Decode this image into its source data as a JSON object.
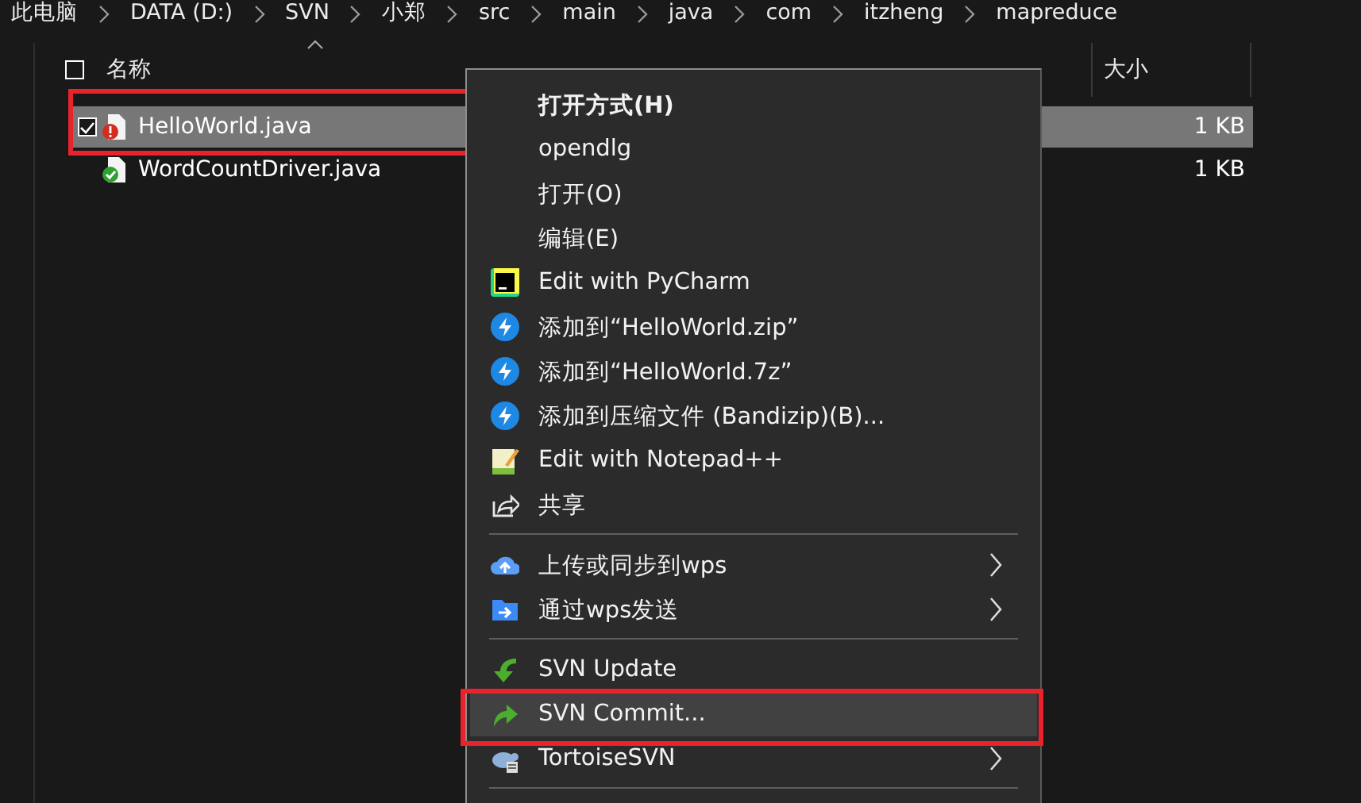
{
  "breadcrumb": [
    "此电脑",
    "DATA (D:)",
    "SVN",
    "小郑",
    "src",
    "main",
    "java",
    "com",
    "itzheng",
    "mapreduce"
  ],
  "file_list": {
    "select_all": {
      "checked": false
    },
    "columns": [
      {
        "label": "名称",
        "sorted": true
      },
      {
        "label": "大小",
        "sorted": false
      }
    ],
    "rows": [
      {
        "name": "HelloWorld.java",
        "size": "1 KB",
        "kind": "modified",
        "selected": true,
        "checked": true,
        "marked": true
      },
      {
        "name": "WordCountDriver.java",
        "size": "1 KB",
        "kind": "normal",
        "selected": false,
        "checked": false,
        "marked": false
      }
    ]
  },
  "context_menu": [
    {
      "kind": "text",
      "label": "打开方式(H)",
      "bold": true,
      "submenu": false,
      "selected": false,
      "marked": false
    },
    {
      "kind": "text",
      "label": "opendlg",
      "bold": false,
      "submenu": false,
      "selected": false,
      "marked": false
    },
    {
      "kind": "text",
      "label": "打开(O)",
      "bold": false,
      "submenu": false,
      "selected": false,
      "marked": false
    },
    {
      "kind": "text",
      "label": "编辑(E)",
      "bold": false,
      "submenu": false,
      "selected": false,
      "marked": false
    },
    {
      "kind": "pycharm",
      "label": "Edit with PyCharm",
      "bold": false,
      "submenu": false,
      "selected": false,
      "marked": false
    },
    {
      "kind": "zip",
      "label": "添加到“HelloWorld.zip”",
      "bold": false,
      "submenu": false,
      "selected": false,
      "marked": false
    },
    {
      "kind": "zip",
      "label": "添加到“HelloWorld.7z”",
      "bold": false,
      "submenu": false,
      "selected": false,
      "marked": false
    },
    {
      "kind": "zip",
      "label": "添加到压缩文件 (Bandizip)(B)...",
      "bold": false,
      "submenu": false,
      "selected": false,
      "marked": false
    },
    {
      "kind": "notepad",
      "label": "Edit with Notepad++",
      "bold": false,
      "submenu": false,
      "selected": false,
      "marked": false
    },
    {
      "kind": "share",
      "label": "共享",
      "bold": false,
      "submenu": false,
      "selected": false,
      "marked": false
    },
    {
      "kind": "separator"
    },
    {
      "kind": "cloud",
      "label": "上传或同步到wps",
      "bold": false,
      "submenu": true,
      "selected": false,
      "marked": false
    },
    {
      "kind": "send",
      "label": "通过wps发送",
      "bold": false,
      "submenu": true,
      "selected": false,
      "marked": false
    },
    {
      "kind": "separator"
    },
    {
      "kind": "update",
      "label": "SVN Update",
      "bold": false,
      "submenu": false,
      "selected": false,
      "marked": false
    },
    {
      "kind": "commit",
      "label": "SVN Commit...",
      "bold": false,
      "submenu": false,
      "selected": true,
      "marked": true
    },
    {
      "kind": "tortoise",
      "label": "TortoiseSVN",
      "bold": false,
      "submenu": true,
      "selected": false,
      "marked": false
    },
    {
      "kind": "separator"
    }
  ]
}
